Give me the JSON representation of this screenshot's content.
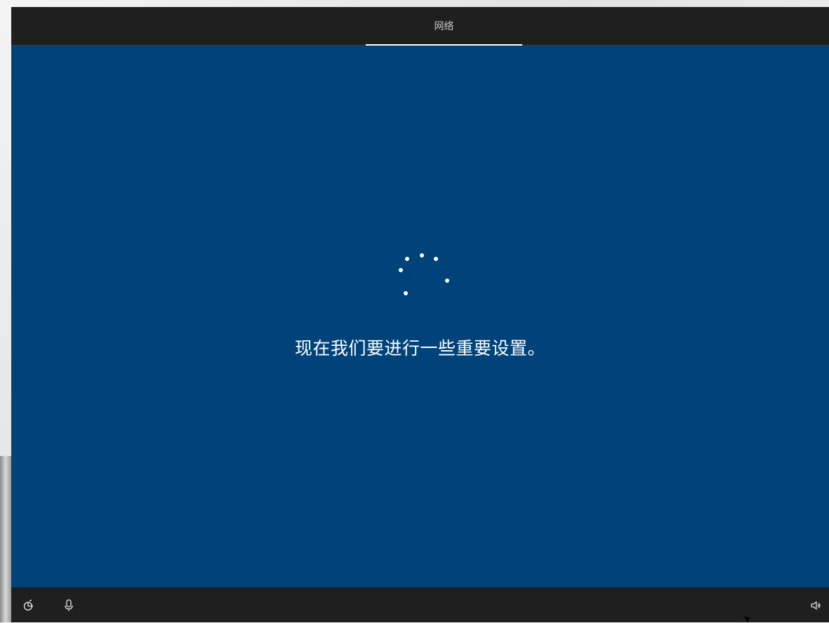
{
  "header": {
    "step_label": "网络"
  },
  "main": {
    "message": "现在我们要进行一些重要设置。",
    "spinner_icon": "loading-spinner-icon"
  },
  "footer": {
    "left_icons": [
      "ease-of-access-icon",
      "microphone-icon"
    ],
    "right_icons": [
      "volume-icon"
    ]
  },
  "colors": {
    "background": "#00437a",
    "bars": "#1f1f1f",
    "text": "#ffffff",
    "tab_text": "#c9c9c9"
  }
}
